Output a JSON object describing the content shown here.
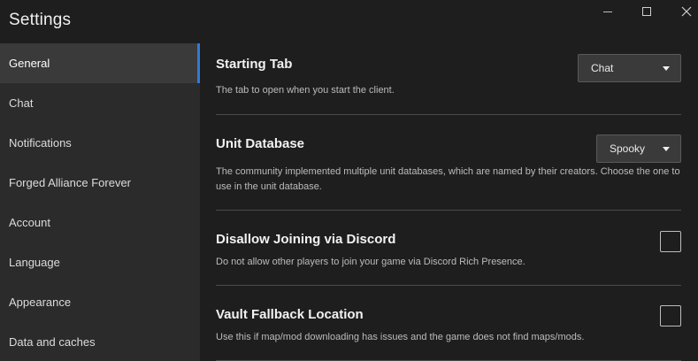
{
  "window": {
    "title": "Settings"
  },
  "sidebar": {
    "items": [
      {
        "label": "General",
        "active": true
      },
      {
        "label": "Chat",
        "active": false
      },
      {
        "label": "Notifications",
        "active": false
      },
      {
        "label": "Forged Alliance Forever",
        "active": false
      },
      {
        "label": "Account",
        "active": false
      },
      {
        "label": "Language",
        "active": false
      },
      {
        "label": "Appearance",
        "active": false
      },
      {
        "label": "Data and caches",
        "active": false
      }
    ]
  },
  "settings": {
    "starting_tab": {
      "title": "Starting Tab",
      "description": "The tab to open when you start the client.",
      "value": "Chat"
    },
    "unit_database": {
      "title": "Unit Database",
      "description": "The community implemented multiple unit databases, which are named by their creators. Choose the one to use in the unit database.",
      "value": "Spooky"
    },
    "disallow_discord": {
      "title": "Disallow Joining via Discord",
      "description": "Do not allow other players to join your game via Discord Rich Presence.",
      "checked": false
    },
    "vault_fallback": {
      "title": "Vault Fallback Location",
      "description": "Use this if map/mod downloading has issues and the game does not find maps/mods.",
      "checked": false
    }
  },
  "colors": {
    "background": "#1e1e1e",
    "sidebar": "#2b2b2b",
    "active_item": "#3a3a3a",
    "accent": "#2f7bd6"
  }
}
